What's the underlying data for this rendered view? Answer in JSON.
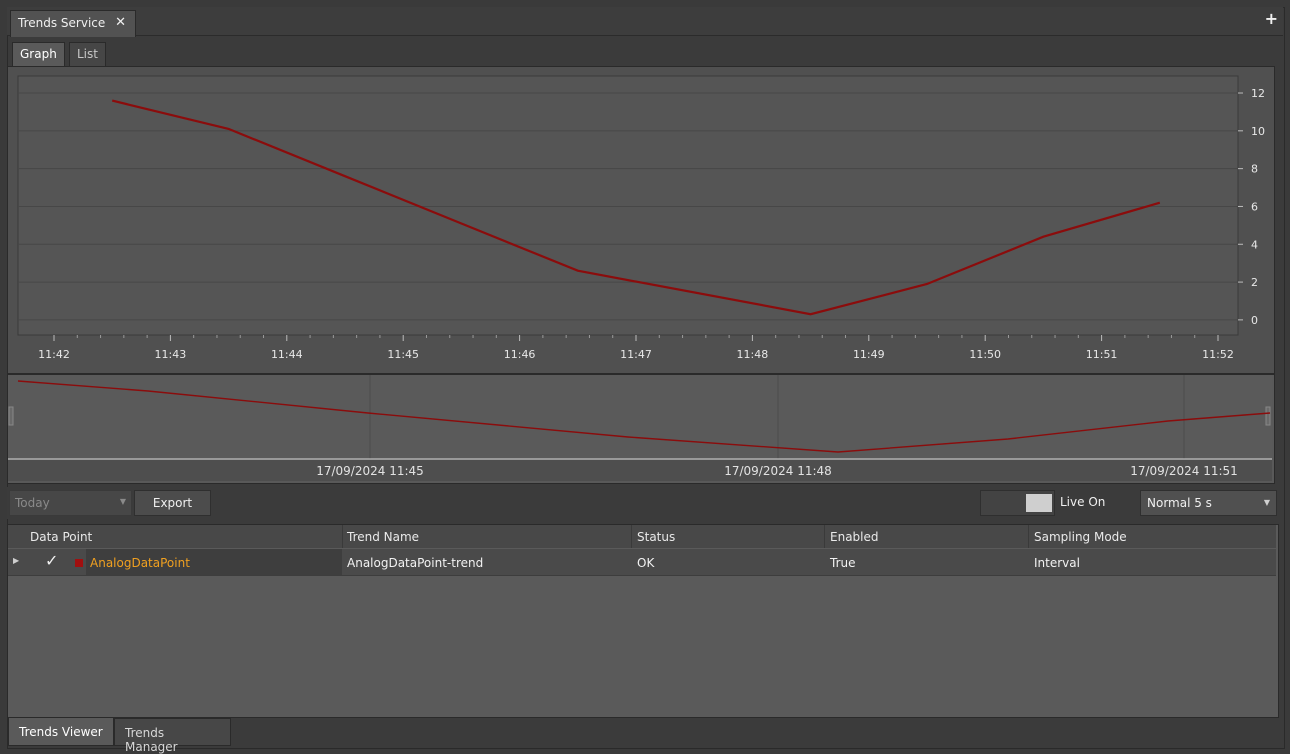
{
  "document_tab": {
    "title": "Trends Service",
    "close": "✕",
    "add": "+"
  },
  "view_tabs": [
    {
      "label": "Graph",
      "active": true
    },
    {
      "label": "List",
      "active": false
    }
  ],
  "chart_data": {
    "type": "line",
    "x": [
      "11:42:30",
      "11:43:30",
      "11:44:30",
      "11:45:30",
      "11:46:30",
      "11:47:30",
      "11:48:30",
      "11:49:30",
      "11:50:30",
      "11:51:30"
    ],
    "series": [
      {
        "values": [
          11.6,
          10.1,
          7.6,
          5.1,
          2.6,
          0.3,
          1.9,
          4.4,
          6.2
        ],
        "x_index": [
          0,
          1,
          2,
          3,
          4,
          6,
          7,
          8,
          9
        ],
        "color": "#8b0c0c"
      }
    ],
    "x_ticks": [
      "11:42",
      "11:43",
      "11:44",
      "11:45",
      "11:46",
      "11:47",
      "11:48",
      "11:49",
      "11:50",
      "11:51",
      "11:52"
    ],
    "y_ticks": [
      "12",
      "10",
      "8",
      "6",
      "4",
      "2",
      "0"
    ],
    "ylim": [
      -0.8,
      12.9
    ],
    "grid": true,
    "y_axis_side": "right"
  },
  "overview": {
    "ticks": [
      "17/09/2024 11:45",
      "17/09/2024 11:48",
      "17/09/2024 11:51"
    ]
  },
  "toolbar": {
    "date_range": "Today",
    "export_label": "Export",
    "live_label": "Live On",
    "interval": "Normal 5 s"
  },
  "table": {
    "columns": [
      "Data Point",
      "Trend Name",
      "Status",
      "Enabled",
      "Sampling Mode"
    ],
    "rows": [
      {
        "data_point": "AnalogDataPoint",
        "trend_name": "AnalogDataPoint-trend",
        "status": "OK",
        "enabled": "True",
        "sampling_mode": "Interval",
        "checked": true,
        "color": "#a10f0f"
      }
    ]
  },
  "bottom_tabs": [
    {
      "label": "Trends Viewer",
      "active": true
    },
    {
      "label": "Trends Manager",
      "active": false
    }
  ],
  "colors": {
    "line": "#8b0c0c",
    "data_point_link": "#f0a020"
  }
}
